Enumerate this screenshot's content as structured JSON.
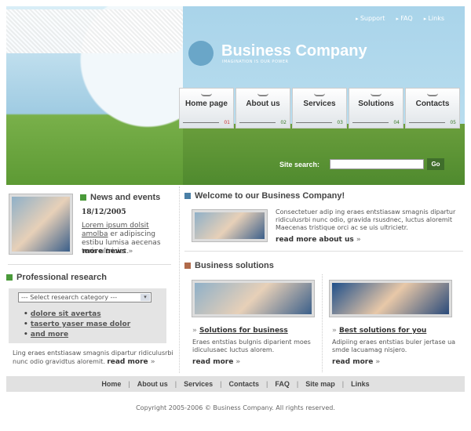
{
  "header": {
    "top_links": [
      "Support",
      "FAQ",
      "Links"
    ],
    "brand": "Business Company",
    "tagline": "IMAGINATION IS OUR POWER",
    "tabs": [
      {
        "label": "Home page",
        "num": "01"
      },
      {
        "label": "About us",
        "num": "02"
      },
      {
        "label": "Services",
        "num": "03"
      },
      {
        "label": "Solutions",
        "num": "04"
      },
      {
        "label": "Contacts",
        "num": "05"
      }
    ],
    "search_label": "Site search:",
    "search_value": "",
    "go_label": "Go"
  },
  "news": {
    "title": "News and events",
    "date": "18/12/2005",
    "link_text": "Lorem ipsum dolsit amolba",
    "text": "er adipiscing estibu lumisa aecenas toris ultriciet.",
    "more": "more news"
  },
  "research": {
    "title": "Professional research",
    "select": "--- Select research category ---",
    "links": [
      "dolore sit avertas",
      "taserto yaser mase dolor",
      "and more"
    ],
    "text": "Ling eraes entstiasaw smagnis dipartur ridiculusrbi nunc odio gravidtus aloremit.",
    "more": "read more"
  },
  "welcome": {
    "title": "Welcome to our Business Company!",
    "text": "Consectetuer adip ing eraes entstiasaw smagnis dipartur ridiculusrbi nunc odio, gravida rsusdnec, luctus aloremit Maecenas tristique orci ac se uis ultricietr.",
    "more": "read more about us"
  },
  "solutions": {
    "title": "Business solutions",
    "items": [
      {
        "title": "Solutions for business",
        "text": "Eraes entstias bulgnis diparient moes idiculusaec luctus alorem.",
        "more": "read more"
      },
      {
        "title": "Best solutions for you",
        "text": "Adipiing eraes entstias buler jertase ua smde lacuamag nisjero.",
        "more": "read more"
      }
    ]
  },
  "footer": {
    "links": [
      "Home",
      "About us",
      "Services",
      "Contacts",
      "FAQ",
      "Site map",
      "Links"
    ],
    "copyright": "Copyright 2005-2006 © Business Company. All rights reserved."
  }
}
